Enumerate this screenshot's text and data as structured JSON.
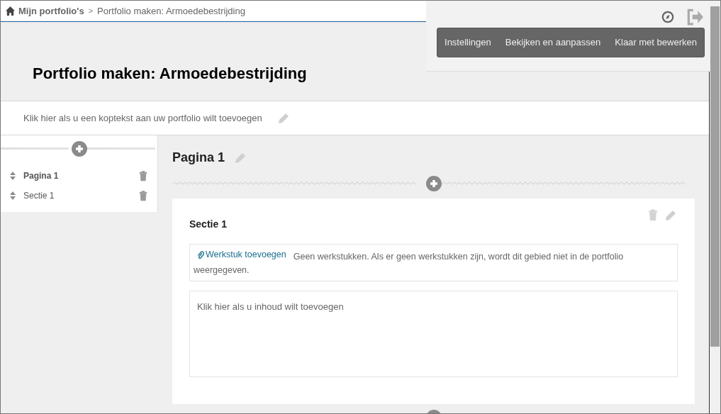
{
  "breadcrumb": {
    "home": "Mijn portfolio's",
    "separator": ">",
    "current": "Portfolio maken: Armoedebestrijding"
  },
  "menu": [
    "Instellingen",
    "Bekijken en aanpassen",
    "Klaar met bewerken"
  ],
  "title": "Portfolio maken: Armoedebestrijding",
  "header_prompt": "Klik hier als u een koptekst aan uw portfolio wilt toevoegen",
  "sidebar": {
    "items": [
      {
        "label": "Pagina 1",
        "kind": "page"
      },
      {
        "label": "Sectie 1",
        "kind": "section"
      }
    ]
  },
  "page": {
    "title": "Pagina 1",
    "section": {
      "title": "Sectie 1",
      "add_link": "Werkstuk toevoegen",
      "note": "Geen werkstukken. Als er geen werkstukken zijn, wordt dit gebied niet in de portfolio weergegeven.",
      "content_prompt": "Klik hier als u inhoud wilt toevoegen"
    }
  }
}
